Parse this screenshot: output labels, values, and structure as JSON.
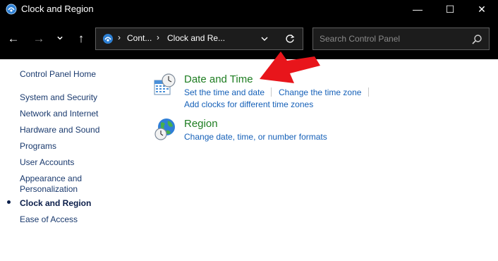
{
  "window": {
    "title": "Clock and Region",
    "minimize_glyph": "—",
    "maximize_glyph": "☐",
    "close_glyph": "✕"
  },
  "nav": {
    "back_glyph": "←",
    "forward_glyph": "→",
    "recent_glyph": "⌄",
    "up_glyph": "↑"
  },
  "address": {
    "sep1": "›",
    "crumb1": "Cont...",
    "sep2": "›",
    "crumb2": "Clock and Re...",
    "dropdown_icon": "chevron-down-icon",
    "refresh_icon": "refresh-icon"
  },
  "search": {
    "placeholder": "Search Control Panel",
    "icon": "search-icon"
  },
  "sidebar": {
    "home": "Control Panel Home",
    "items": [
      "System and Security",
      "Network and Internet",
      "Hardware and Sound",
      "Programs",
      "User Accounts",
      "Appearance and",
      "Personalization",
      "Clock and Region",
      "Ease of Access"
    ]
  },
  "categories": {
    "date_time": {
      "title": "Date and Time",
      "link1": "Set the time and date",
      "link2": "Change the time zone",
      "link3": "Add clocks for different time zones"
    },
    "region": {
      "title": "Region",
      "link1": "Change date, time, or number formats"
    }
  },
  "colors": {
    "titlebar": "#000000",
    "link": "#1560b8",
    "category_title": "#1e7d21",
    "annotation_arrow": "#e8151b"
  }
}
